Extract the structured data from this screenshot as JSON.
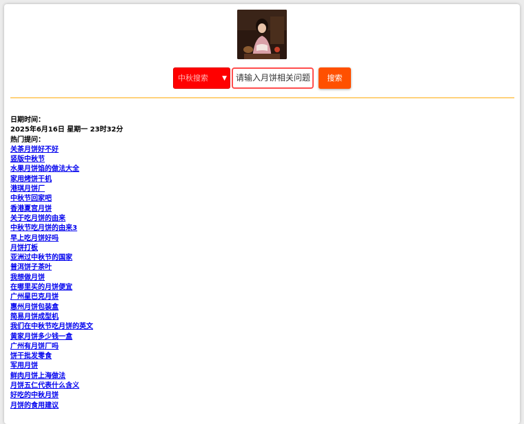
{
  "search": {
    "category": "中秋搜索",
    "input_value": "请输入月饼相关问题",
    "button_label": "搜索"
  },
  "info": {
    "date_label": "日期时间：",
    "date_value": "2025年6月16日 星期一 23时32分",
    "hot_label": "热门提问："
  },
  "hot_questions": [
    "关茶月饼好不好",
    "竖版中秋节",
    "水果月饼馅的做法大全",
    "家用烤饼干机",
    "港琪月饼厂",
    "中秋节回家吧",
    "香港夏宫月饼",
    "关于吃月饼的由来",
    "中秋节吃月饼的由来3",
    "早上吃月饼好吗",
    "月饼打板",
    "亚洲过中秋节的国家",
    "普洱饼子茶叶",
    "我想做月饼",
    "在哪里买的月饼便宜",
    "广州星巴克月饼",
    "惠州月饼包装盒",
    "简易月饼成型机",
    "我们在中秋节吃月饼的英文",
    "黄家月饼多少钱一盒",
    "广州有月饼厂吗",
    "饼干批发零食",
    "军用月饼",
    "鲜肉月饼上海做法",
    "月饼五仁代表什么含义",
    "好吃的中秋月饼",
    "月饼的食用建议"
  ],
  "colors": {
    "select_bg": "#ff0000",
    "button_bg": "#ff5000",
    "input_border": "#ff4d4d",
    "divider": "#ffd27a",
    "link": "#0000ee"
  }
}
